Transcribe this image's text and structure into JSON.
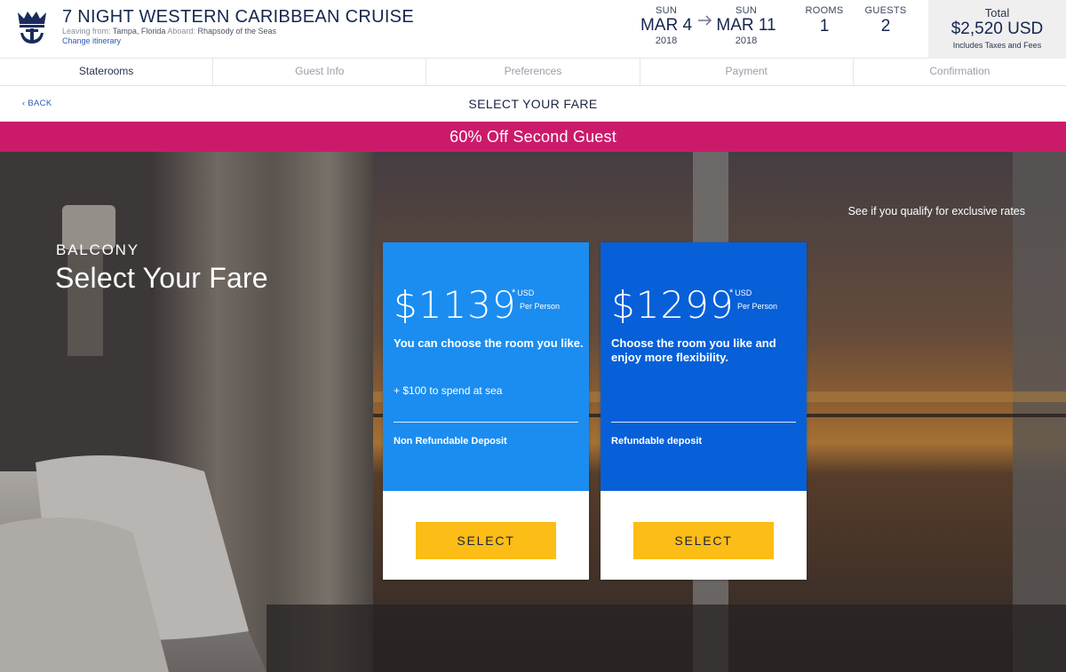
{
  "header": {
    "title": "7 NIGHT WESTERN CARIBBEAN CRUISE",
    "leaving_label": "Leaving from:",
    "leaving_value": "Tampa, Florida",
    "aboard_label": "Aboard:",
    "aboard_value": "Rhapsody of the Seas",
    "change_link": "Change itinerary",
    "start_date": {
      "dow": "SUN",
      "month_day": "MAR 4",
      "year": "2018"
    },
    "end_date": {
      "dow": "SUN",
      "month_day": "MAR 11",
      "year": "2018"
    },
    "rooms": {
      "label": "ROOMS",
      "value": "1"
    },
    "guests": {
      "label": "GUESTS",
      "value": "2"
    },
    "total": {
      "label": "Total",
      "amount": "$2,520 USD",
      "note": "Includes Taxes and Fees"
    }
  },
  "steps": [
    {
      "label": "Staterooms",
      "active": true
    },
    {
      "label": "Guest Info",
      "active": false
    },
    {
      "label": "Preferences",
      "active": false
    },
    {
      "label": "Payment",
      "active": false
    },
    {
      "label": "Confirmation",
      "active": false
    }
  ],
  "subbar": {
    "back_label": "BACK",
    "heading": "SELECT YOUR FARE"
  },
  "promo": "60% Off Second Guest",
  "hero": {
    "category": "BALCONY",
    "title": "Select Your Fare",
    "qualify_link": "See if you qualify for exclusive rates"
  },
  "fares": [
    {
      "price": "$1139",
      "star": "*",
      "currency": "USD",
      "per": "Per Person",
      "description": "You can choose the room you like.",
      "perk": "+ $100 to spend at sea",
      "deposit": "Non Refundable Deposit",
      "button": "SELECT",
      "color": "#1b8df0"
    },
    {
      "price": "$1299",
      "star": "*",
      "currency": "USD",
      "per": "Per Person",
      "description": "Choose the room you like and enjoy more flexibility.",
      "perk": "",
      "deposit": "Refundable deposit",
      "button": "SELECT",
      "color": "#0760d8"
    }
  ],
  "colors": {
    "promo": "#cc1a6b",
    "navy": "#15264f",
    "select_button": "#fbbd16",
    "link": "#2a5ab7"
  },
  "icons": {
    "logo": "crown-anchor-logo",
    "date_arrow": "arrow-right-icon",
    "back": "chevron-left-icon"
  }
}
